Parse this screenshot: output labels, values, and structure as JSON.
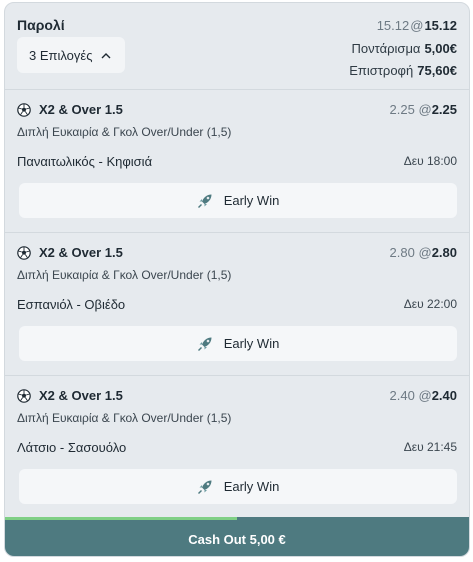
{
  "header": {
    "title": "Παρολί",
    "selections_label": "3 Επιλογές",
    "odds_old": "15.12",
    "odds_at": "@",
    "odds_new": "15.12",
    "stake_label": "Ποντάρισμα",
    "stake_value": "5,00€",
    "return_label": "Επιστροφή",
    "return_value": "75,60€"
  },
  "selections": [
    {
      "name": "X2 & Over 1.5",
      "market": "Διπλή Ευκαιρία & Γκολ Over/Under (1,5)",
      "odds_old": "2.25",
      "odds_at": "@",
      "odds_new": "2.25",
      "match": "Παναιτωλικός - Κηφισιά",
      "time": "Δευ 18:00",
      "early_win_label": "Early Win"
    },
    {
      "name": "X2 & Over 1.5",
      "market": "Διπλή Ευκαιρία & Γκολ Over/Under (1,5)",
      "odds_old": "2.80",
      "odds_at": "@",
      "odds_new": "2.80",
      "match": "Εσπανιόλ - Οβιέδο",
      "time": "Δευ 22:00",
      "early_win_label": "Early Win"
    },
    {
      "name": "X2 & Over 1.5",
      "market": "Διπλή Ευκαιρία & Γκολ Over/Under (1,5)",
      "odds_old": "2.40",
      "odds_at": "@",
      "odds_new": "2.40",
      "match": "Λάτσιο - Σασουόλο",
      "time": "Δευ 21:45",
      "early_win_label": "Early Win"
    }
  ],
  "cashout": {
    "label": "Cash Out 5,00 €",
    "progress_fraction": 0.5
  },
  "icons": {
    "selection_icon": "football-icon",
    "early_win_icon": "early-win-rocket-icon",
    "selections_toggle_icon": "chevron-up-icon"
  },
  "colors": {
    "card_background": "#e6eaee",
    "button_background": "#f5f7f9",
    "cashout_background": "#4e7a80",
    "progress_fill": "#7fcf85"
  }
}
